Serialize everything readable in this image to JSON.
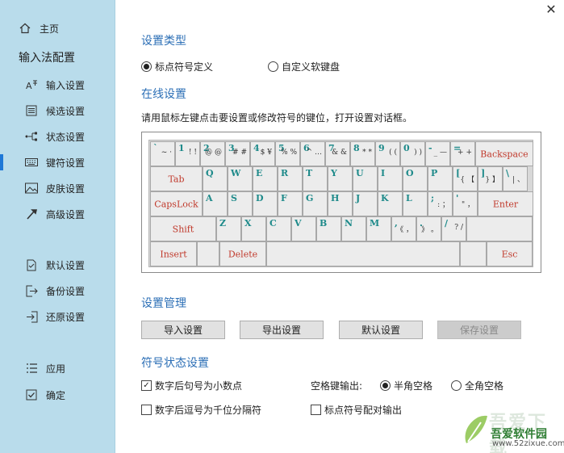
{
  "window": {
    "close_glyph": "✕"
  },
  "sidebar": {
    "home": {
      "label": "主页",
      "icon": "home-icon"
    },
    "title": "输入法配置",
    "items": [
      {
        "label": "输入设置",
        "icon": "input-icon"
      },
      {
        "label": "候选设置",
        "icon": "candidate-icon"
      },
      {
        "label": "状态设置",
        "icon": "status-icon"
      },
      {
        "label": "键符设置",
        "icon": "keyboard-icon",
        "active": true
      },
      {
        "label": "皮肤设置",
        "icon": "skin-icon"
      },
      {
        "label": "高级设置",
        "icon": "advanced-icon"
      },
      {
        "label": "默认设置",
        "icon": "default-icon"
      },
      {
        "label": "备份设置",
        "icon": "backup-icon"
      },
      {
        "label": "还原设置",
        "icon": "restore-icon"
      },
      {
        "label": "应用",
        "icon": "apply-icon"
      },
      {
        "label": "确定",
        "icon": "confirm-icon"
      }
    ]
  },
  "type_section": {
    "title": "设置类型",
    "options": [
      {
        "label": "标点符号定义",
        "selected": true
      },
      {
        "label": "自定义软键盘",
        "selected": false
      }
    ]
  },
  "online_section": {
    "title": "在线设置",
    "hint": "请用鼠标左键点击要设置或修改符号的键位，打开设置对话框。"
  },
  "keyboard": {
    "row1": [
      {
        "n": "`",
        "s": "~ ·"
      },
      {
        "n": "1",
        "s": "! !"
      },
      {
        "n": "2",
        "s": "@ @"
      },
      {
        "n": "3",
        "s": "# #"
      },
      {
        "n": "4",
        "s": "$ ¥"
      },
      {
        "n": "5",
        "s": "% %"
      },
      {
        "n": "6",
        "s": "^ …"
      },
      {
        "n": "7",
        "s": "& &"
      },
      {
        "n": "8",
        "s": "* *"
      },
      {
        "n": "9",
        "s": "( ("
      },
      {
        "n": "0",
        "s": ") )"
      },
      {
        "n": "-",
        "s": "_ —"
      },
      {
        "n": "=",
        "s": "+ +"
      }
    ],
    "backspace": "Backspace",
    "tab": "Tab",
    "row2": [
      "Q",
      "W",
      "E",
      "R",
      "T",
      "Y",
      "U",
      "I",
      "O",
      "P"
    ],
    "row2_sym": [
      {
        "n": "[",
        "s": "{ 【"
      },
      {
        "n": "]",
        "s": "} 】"
      },
      {
        "n": "\\",
        "s": "| 、"
      }
    ],
    "caps": "CapsLock",
    "row3": [
      "A",
      "S",
      "D",
      "F",
      "G",
      "H",
      "J",
      "K",
      "L"
    ],
    "row3_sym": [
      {
        "n": ";",
        "s": ": ；"
      },
      {
        "n": "'",
        "s": "\" ，"
      }
    ],
    "enter": "Enter",
    "shift": "Shift",
    "row4": [
      "Z",
      "X",
      "C",
      "V",
      "B",
      "N",
      "M"
    ],
    "row4_sym": [
      {
        "n": ",",
        "s": "《 ，"
      },
      {
        "n": ".",
        "s": "》 。"
      },
      {
        "n": "/",
        "s": "? /"
      }
    ],
    "insert": "Insert",
    "delete": "Delete",
    "esc": "Esc"
  },
  "manage_section": {
    "title": "设置管理",
    "buttons": [
      {
        "label": "导入设置",
        "enabled": true
      },
      {
        "label": "导出设置",
        "enabled": true
      },
      {
        "label": "默认设置",
        "enabled": true
      },
      {
        "label": "保存设置",
        "enabled": false
      }
    ]
  },
  "symbol_section": {
    "title": "符号状态设置",
    "check1": {
      "label": "数字后句号为小数点",
      "checked": true
    },
    "check2": {
      "label": "数字后逗号为千位分隔符",
      "checked": false
    },
    "check3": {
      "label": "标点符号配对输出",
      "checked": false
    },
    "space_label": "空格键输出:",
    "space_options": [
      {
        "label": "半角空格",
        "selected": true
      },
      {
        "label": "全角空格",
        "selected": false
      }
    ]
  },
  "watermark": {
    "line1": "吾爱下载",
    "line2": "吾爱软件园",
    "line3": "www.52zixue.com"
  },
  "colors": {
    "sidebar_bg": "#b9dceb",
    "accent": "#2c6fb6",
    "key_letter": "#1e8a8a",
    "key_func": "#c0392b"
  }
}
